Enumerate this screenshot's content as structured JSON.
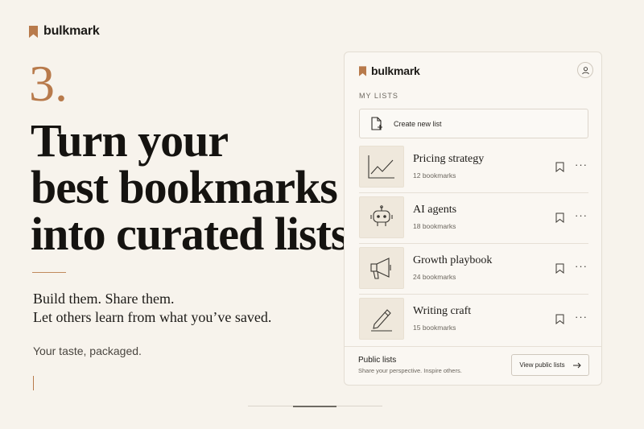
{
  "brand": {
    "name": "bulkmark",
    "icon": "bookmark-icon",
    "accent_color": "#b87a4b"
  },
  "hero": {
    "step": "3.",
    "headline": [
      "Turn your",
      "best bookmarks",
      "into curated lists."
    ],
    "subtext": [
      "Build them. Share them.",
      "Let others learn from what you’ve saved."
    ],
    "tagline": "Your taste, packaged."
  },
  "panel": {
    "brand_name": "bulkmark",
    "avatar_icon": "user-icon",
    "section_label": "MY LISTS",
    "create_label": "Create new list",
    "lists": [
      {
        "title": "Pricing strategy",
        "count": "12 bookmarks",
        "icon": "line-chart-icon"
      },
      {
        "title": "AI agents",
        "count": "18 bookmarks",
        "icon": "robot-icon"
      },
      {
        "title": "Growth playbook",
        "count": "24 bookmarks",
        "icon": "megaphone-icon"
      },
      {
        "title": "Writing craft",
        "count": "15 bookmarks",
        "icon": "pencil-icon"
      }
    ],
    "footer": {
      "title": "Public lists",
      "subtitle": "Share your perspective. Inspire others.",
      "button_label": "View public lists"
    }
  }
}
